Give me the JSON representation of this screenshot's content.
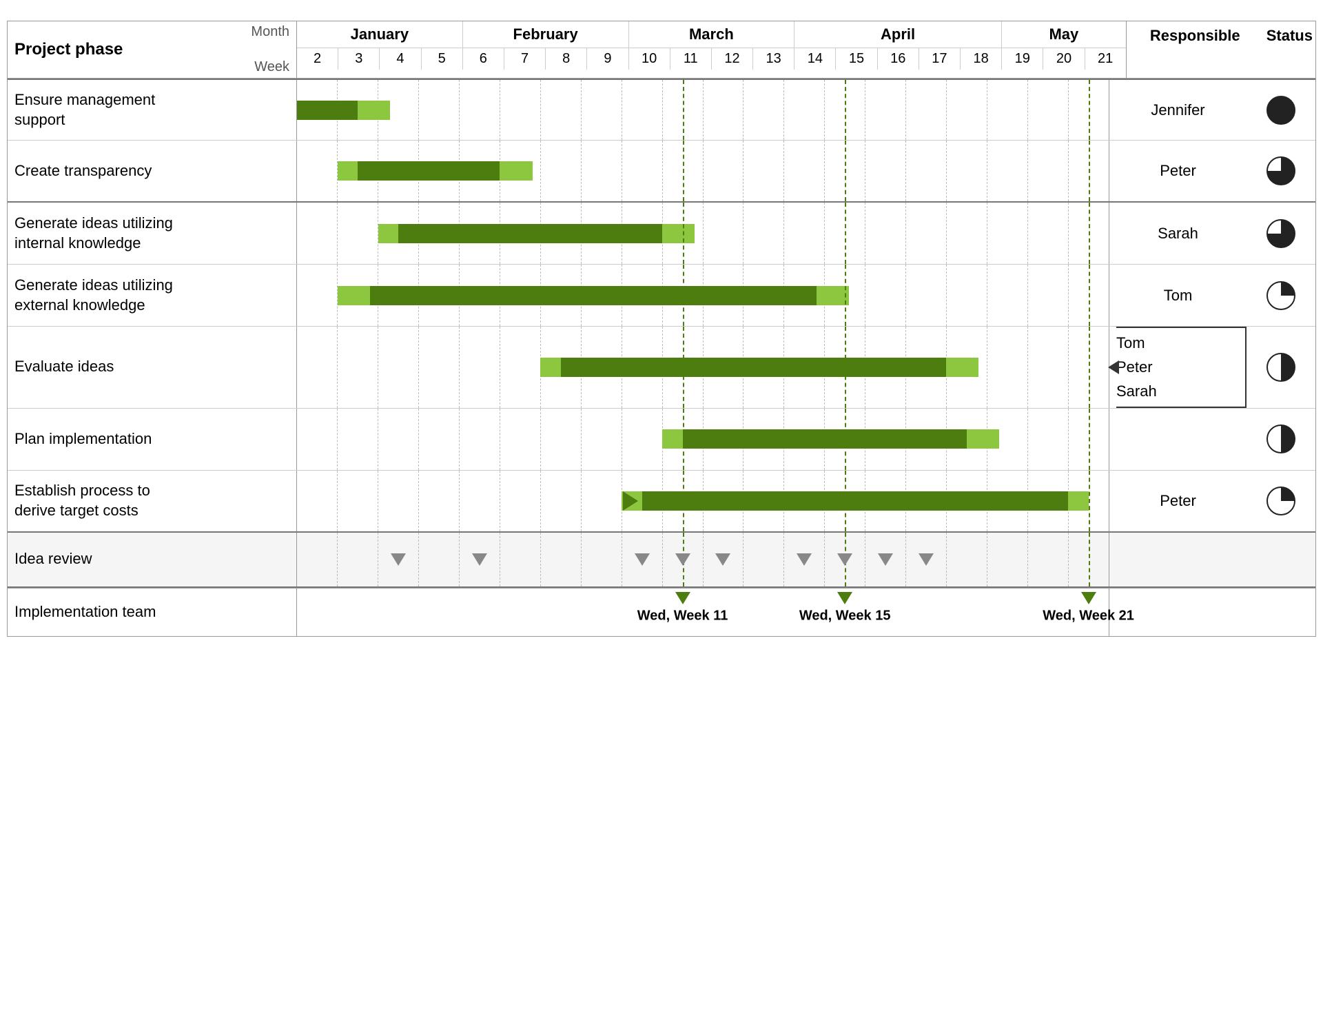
{
  "header": {
    "month_label": "Month",
    "week_label": "Week",
    "phase_label": "Project phase",
    "responsible_label": "Responsible",
    "status_label": "Status"
  },
  "months": [
    {
      "name": "January",
      "weeks": [
        "2",
        "3",
        "4",
        "5"
      ],
      "span": 4
    },
    {
      "name": "February",
      "weeks": [
        "6",
        "7",
        "8",
        "9"
      ],
      "span": 4
    },
    {
      "name": "March",
      "weeks": [
        "10",
        "11",
        "12",
        "13"
      ],
      "span": 4
    },
    {
      "name": "April",
      "weeks": [
        "14",
        "15",
        "16",
        "17",
        "18"
      ],
      "span": 5
    },
    {
      "name": "May",
      "weeks": [
        "19",
        "20",
        "21"
      ],
      "span": 3
    }
  ],
  "weeks": [
    "2",
    "3",
    "4",
    "5",
    "6",
    "7",
    "8",
    "9",
    "10",
    "11",
    "12",
    "13",
    "14",
    "15",
    "16",
    "17",
    "18",
    "19",
    "20",
    "21"
  ],
  "tasks": [
    {
      "label": "Ensure management support",
      "responsible": "Jennifer",
      "status": "full",
      "bar_start_week": 2,
      "bar_light_weeks": 1,
      "bar_dark_weeks": 1,
      "bar_start_idx": 0,
      "bar_light_count": 1,
      "bar_dark_count": 1
    },
    {
      "label": "Create transparency",
      "responsible": "Peter",
      "status": "three-quarter",
      "bar_start_idx": 1,
      "bar_light_count": 2,
      "bar_dark_count": 3
    }
  ],
  "milestone_labels": [
    {
      "label": "Wed, Week 11",
      "week_idx": 9
    },
    {
      "label": "Wed, Week 15",
      "week_idx": 13
    },
    {
      "label": "Wed, Week 21",
      "week_idx": 19
    }
  ],
  "bottom_section_label": "Implementation team",
  "colors": {
    "bar_light": "#8dc63f",
    "bar_dark": "#4d7c0f",
    "dashed_line": "#4d7c0f",
    "triangle": "#888888",
    "bracket": "#333333"
  }
}
